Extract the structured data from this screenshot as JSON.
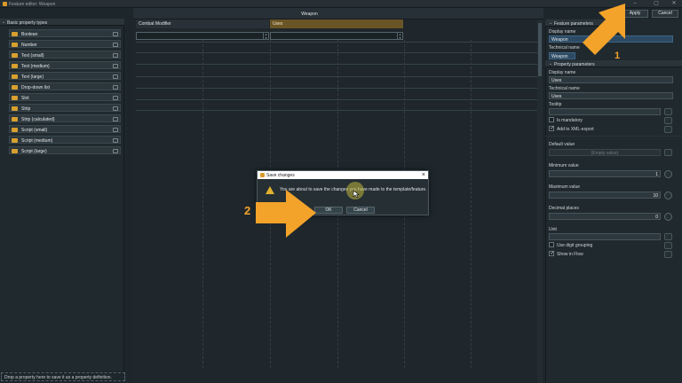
{
  "window": {
    "title": "Feature editor: Weapon"
  },
  "window_controls": {
    "minimize": "–",
    "maximize": "▢",
    "close": "✕"
  },
  "left_panel": {
    "header": "Basic property types",
    "items": [
      "Boolean",
      "Number",
      "Text (small)",
      "Text (medium)",
      "Text (large)",
      "Drop-down list",
      "Slot",
      "Strip",
      "Strip (calculated)",
      "Script (small)",
      "Script (medium)",
      "Script (large)"
    ],
    "drop_hint": "Drop a property here to save it as a property definition."
  },
  "center": {
    "title": "Weapon",
    "columns": [
      "Combat Modifier",
      "Uses"
    ]
  },
  "top_buttons": {
    "apply": "Apply",
    "cancel": "Cancel"
  },
  "right_panel": {
    "feature_section": "Feature parameters",
    "property_section": "Property parameters",
    "feature": {
      "display_name_label": "Display name",
      "display_name": "Weapon",
      "technical_name_label": "Technical name",
      "technical_name": "Weapon"
    },
    "property": {
      "display_name_label": "Display name",
      "display_name": "Uses",
      "technical_name_label": "Technical name",
      "technical_name": "Uses",
      "tooltip_label": "Tooltip",
      "is_mandatory": "Is mandatory",
      "add_to_xml": "Add to XML-export",
      "default_value_label": "Default value",
      "default_value_placeholder": "(Empty value)",
      "minimum_value_label": "Minimum value",
      "minimum_value": "1",
      "maximum_value_label": "Maximum value",
      "maximum_value": "10",
      "decimal_places_label": "Decimal places",
      "decimal_places": "0",
      "unit_label": "Unit",
      "use_digit_grouping": "Use digit grouping",
      "show_in_flow": "Show in Flow"
    },
    "checkbox_states": {
      "is_mandatory": false,
      "add_to_xml": true,
      "use_digit_grouping": false,
      "show_in_flow": true
    }
  },
  "dialog": {
    "title": "Save changes",
    "message": "You are about to save the changes you have made to the template/feature.",
    "ok": "OK",
    "cancel": "Cancel"
  },
  "annotations": {
    "marker_1": "1",
    "marker_2": "2",
    "accent_color": "#f3a32a"
  }
}
